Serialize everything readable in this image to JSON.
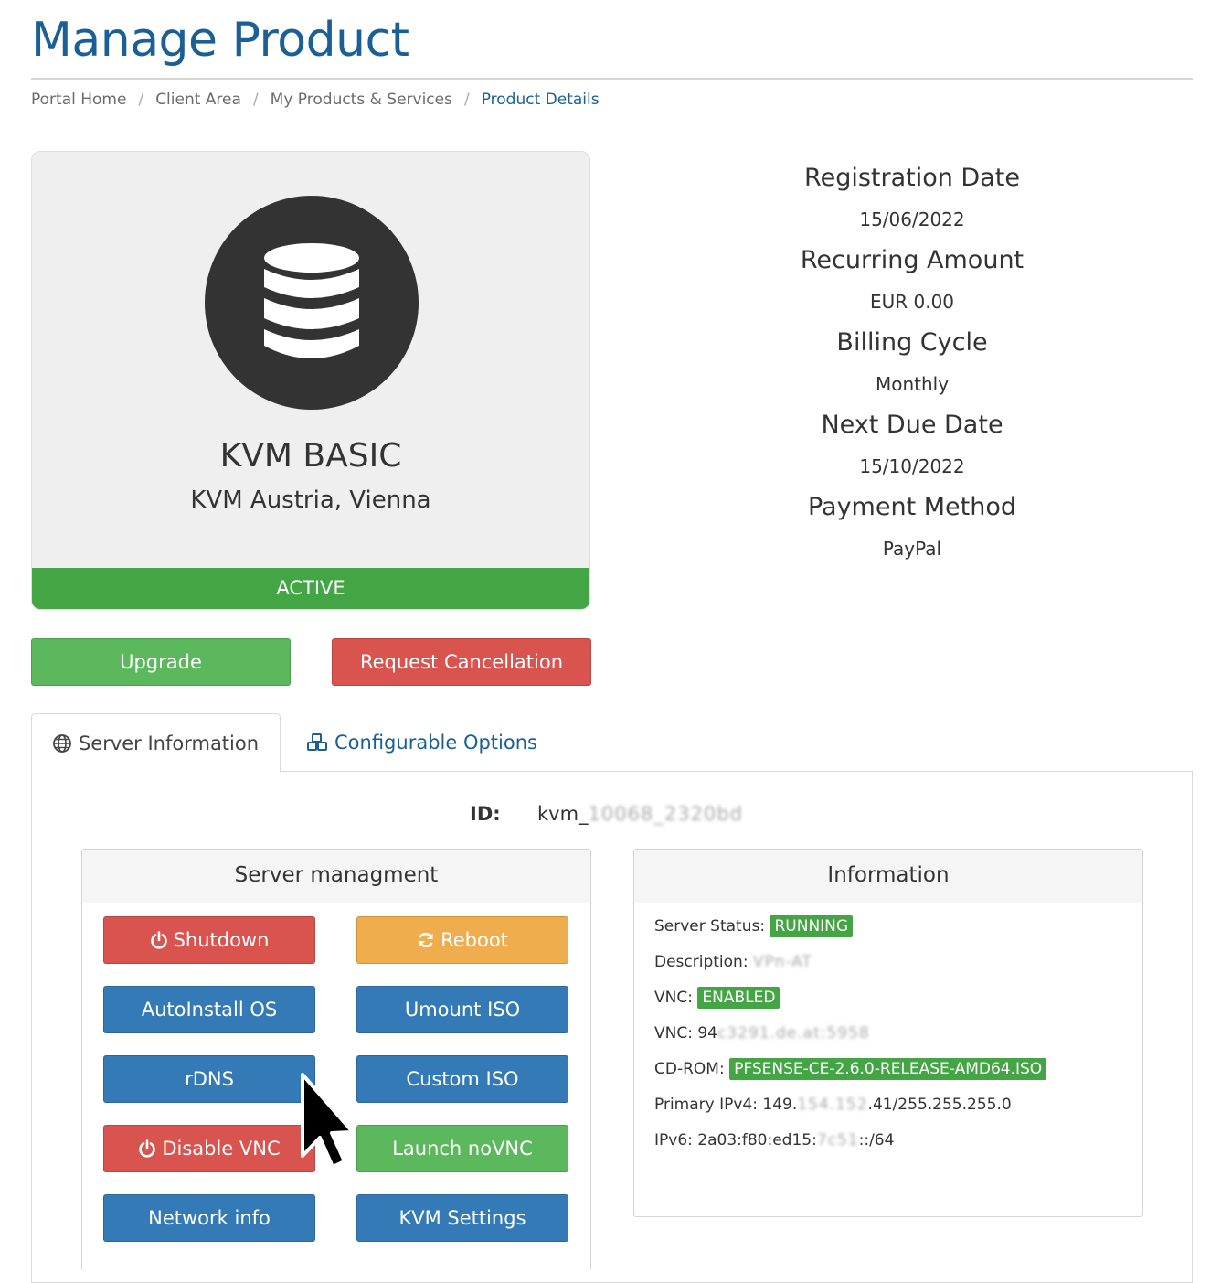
{
  "page": {
    "title": "Manage Product"
  },
  "breadcrumb": {
    "items": [
      "Portal Home",
      "Client Area",
      "My Products & Services"
    ],
    "active": "Product Details"
  },
  "product": {
    "icon": "database-icon",
    "name": "KVM BASIC",
    "group": "KVM Austria, Vienna",
    "status": "ACTIVE"
  },
  "summary": {
    "registration_label": "Registration Date",
    "registration_value": "15/06/2022",
    "recurring_label": "Recurring Amount",
    "recurring_value": "EUR 0.00",
    "cycle_label": "Billing Cycle",
    "cycle_value": "Monthly",
    "due_label": "Next Due Date",
    "due_value": "15/10/2022",
    "payment_label": "Payment Method",
    "payment_value": "PayPal"
  },
  "actions": {
    "upgrade": "Upgrade",
    "cancel": "Request Cancellation"
  },
  "tabs": {
    "server_info": "Server Information",
    "config_options": "Configurable Options"
  },
  "server": {
    "id_label": "ID:",
    "id_value": "kvm_10068_2320bd"
  },
  "management": {
    "title": "Server managment",
    "shutdown": "Shutdown",
    "reboot": "Reboot",
    "autoinstall": "AutoInstall OS",
    "umount": "Umount ISO",
    "rdns": "rDNS",
    "custom_iso": "Custom ISO",
    "disable_vnc": "Disable VNC",
    "launch_novnc": "Launch noVNC",
    "network_info": "Network info",
    "kvm_settings": "KVM Settings"
  },
  "information": {
    "title": "Information",
    "status_label": "Server Status:",
    "status_value": "RUNNING",
    "description_label": "Description:",
    "description_value": "VPn-AT",
    "vnc_label": "VNC:",
    "vnc_state": "ENABLED",
    "vnc2_label": "VNC:",
    "vnc2_prefix": "94",
    "vnc2_hidden": "c3291.de.at:5958",
    "cdrom_label": "CD-ROM:",
    "cdrom_value": "PFSENSE-CE-2.6.0-RELEASE-AMD64.ISO",
    "ipv4_label": "Primary IPv4:",
    "ipv4_prefix": "149.",
    "ipv4_hidden": "154.152",
    "ipv4_suffix": ".41/255.255.255.0",
    "ipv6_label": "IPv6:",
    "ipv6_prefix": "2a03:f80:ed15:",
    "ipv6_hidden": "7c51",
    "ipv6_suffix": "::/64"
  },
  "colors": {
    "brand_blue": "#1a5f96",
    "success": "#5cb85c",
    "danger": "#d9534f",
    "warning": "#f0ad4e",
    "primary": "#337ab7"
  }
}
